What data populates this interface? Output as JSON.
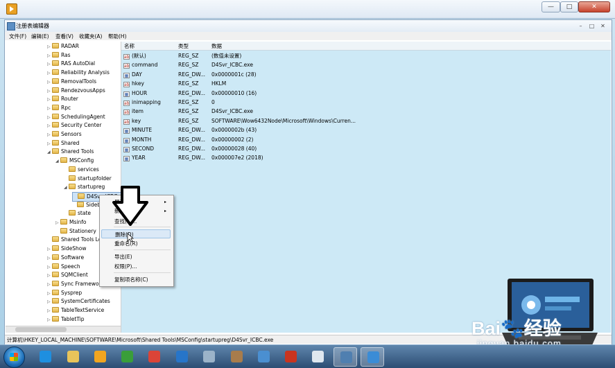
{
  "regedit": {
    "title": "注册表编辑器",
    "menus": [
      "文件(F)",
      "编辑(E)",
      "查看(V)",
      "收藏夹(A)",
      "帮助(H)"
    ],
    "title_controls": {
      "min": "–",
      "max": "□",
      "close": "✕"
    }
  },
  "outer_controls": {
    "min": "—",
    "max": "□",
    "close": "✕"
  },
  "tree": [
    {
      "label": "RADAR",
      "indent": 0,
      "arrow": "▷"
    },
    {
      "label": "Ras",
      "indent": 0,
      "arrow": "▷"
    },
    {
      "label": "RAS AutoDial",
      "indent": 0,
      "arrow": "▷"
    },
    {
      "label": "Reliability Analysis",
      "indent": 0,
      "arrow": "▷"
    },
    {
      "label": "RemovalTools",
      "indent": 0,
      "arrow": "▷"
    },
    {
      "label": "RendezvousApps",
      "indent": 0,
      "arrow": "▷"
    },
    {
      "label": "Router",
      "indent": 0,
      "arrow": "▷"
    },
    {
      "label": "Rpc",
      "indent": 0,
      "arrow": "▷"
    },
    {
      "label": "SchedulingAgent",
      "indent": 0,
      "arrow": "▷"
    },
    {
      "label": "Security Center",
      "indent": 0,
      "arrow": "▷"
    },
    {
      "label": "Sensors",
      "indent": 0,
      "arrow": "▷"
    },
    {
      "label": "Shared",
      "indent": 0,
      "arrow": "▷"
    },
    {
      "label": "Shared Tools",
      "indent": 0,
      "arrow": "◢"
    },
    {
      "label": "MSConfig",
      "indent": 1,
      "arrow": "◢"
    },
    {
      "label": "services",
      "indent": 2,
      "arrow": ""
    },
    {
      "label": "startupfolder",
      "indent": 2,
      "arrow": ""
    },
    {
      "label": "startupreg",
      "indent": 2,
      "arrow": "◢"
    },
    {
      "label": "D4Svr_ICBC.exe",
      "indent": 3,
      "arrow": "",
      "selected": true
    },
    {
      "label": "Sidebar",
      "indent": 3,
      "arrow": ""
    },
    {
      "label": "state",
      "indent": 2,
      "arrow": ""
    },
    {
      "label": "Msinfo",
      "indent": 1,
      "arrow": "▷"
    },
    {
      "label": "Stationery",
      "indent": 1,
      "arrow": ""
    },
    {
      "label": "Shared Tools Location",
      "indent": 0,
      "arrow": ""
    },
    {
      "label": "SideShow",
      "indent": 0,
      "arrow": "▷"
    },
    {
      "label": "Software",
      "indent": 0,
      "arrow": "▷"
    },
    {
      "label": "Speech",
      "indent": 0,
      "arrow": "▷"
    },
    {
      "label": "SQMClient",
      "indent": 0,
      "arrow": "▷"
    },
    {
      "label": "Sync Framework",
      "indent": 0,
      "arrow": "▷"
    },
    {
      "label": "Sysprep",
      "indent": 0,
      "arrow": "▷"
    },
    {
      "label": "SystemCertificates",
      "indent": 0,
      "arrow": "▷"
    },
    {
      "label": "TableTextService",
      "indent": 0,
      "arrow": "▷"
    },
    {
      "label": "TabletTip",
      "indent": 0,
      "arrow": "▷"
    }
  ],
  "columns": {
    "name": "名称",
    "type": "类型",
    "data": "数据"
  },
  "values": [
    {
      "name": "(默认)",
      "type": "REG_SZ",
      "data": "(数值未设置)",
      "icon": "ab"
    },
    {
      "name": "command",
      "type": "REG_SZ",
      "data": "D4Svr_ICBC.exe",
      "icon": "ab"
    },
    {
      "name": "DAY",
      "type": "REG_DW...",
      "data": "0x0000001c (28)",
      "icon": "bin"
    },
    {
      "name": "hkey",
      "type": "REG_SZ",
      "data": "HKLM",
      "icon": "ab"
    },
    {
      "name": "HOUR",
      "type": "REG_DW...",
      "data": "0x00000010 (16)",
      "icon": "bin"
    },
    {
      "name": "inimapping",
      "type": "REG_SZ",
      "data": "0",
      "icon": "ab"
    },
    {
      "name": "item",
      "type": "REG_SZ",
      "data": "D4Svr_ICBC.exe",
      "icon": "ab"
    },
    {
      "name": "key",
      "type": "REG_SZ",
      "data": "SOFTWARE\\Wow6432Node\\Microsoft\\Windows\\Curren...",
      "icon": "ab"
    },
    {
      "name": "MINUTE",
      "type": "REG_DW...",
      "data": "0x0000002b (43)",
      "icon": "bin"
    },
    {
      "name": "MONTH",
      "type": "REG_DW...",
      "data": "0x00000002 (2)",
      "icon": "bin"
    },
    {
      "name": "SECOND",
      "type": "REG_DW...",
      "data": "0x00000028 (40)",
      "icon": "bin"
    },
    {
      "name": "YEAR",
      "type": "REG_DW...",
      "data": "0x000007e2 (2018)",
      "icon": "bin"
    }
  ],
  "context_menu": {
    "items": [
      {
        "label": "展开",
        "submenu": "▸"
      },
      {
        "label": "新建(N)",
        "submenu": "▸"
      },
      {
        "label": "查找(F)..."
      },
      {
        "label": "删除(D)",
        "highlighted": true
      },
      {
        "label": "重命名(R)"
      },
      {
        "label": "导出(E)"
      },
      {
        "label": "权限(P)..."
      },
      {
        "label": "复制项名称(C)"
      }
    ]
  },
  "status_path": "计算机\\HKEY_LOCAL_MACHINE\\SOFTWARE\\Microsoft\\Shared Tools\\MSConfig\\startupreg\\D4Svr_ICBC.exe",
  "watermark": {
    "baidu": "Bai",
    "baidu_suffix": "经验",
    "site": "jingyan.baidu.com"
  },
  "colors": {
    "accent": "#cde9f6",
    "selection": "#cde3f7",
    "taskbar": "#2c4d73"
  },
  "taskbar": [
    {
      "name": "ie-icon",
      "color": "#1e8fe0"
    },
    {
      "name": "explorer-icon",
      "color": "#e8c45a"
    },
    {
      "name": "media-player-icon",
      "color": "#f1a520"
    },
    {
      "name": "tool-icon",
      "color": "#3a9e3a"
    },
    {
      "name": "chrome-icon",
      "color": "#db4437"
    },
    {
      "name": "browser-icon",
      "color": "#2775c9"
    },
    {
      "name": "network-icon",
      "color": "#9bb3c9"
    },
    {
      "name": "paint-icon",
      "color": "#a87c4c"
    },
    {
      "name": "remote-desktop-icon",
      "color": "#4a8fd1"
    },
    {
      "name": "chess-icon",
      "color": "#c9341f"
    },
    {
      "name": "gear-icon",
      "color": "#dfe7ef"
    },
    {
      "name": "monitor-icon",
      "color": "#4f7fb0"
    },
    {
      "name": "regedit-icon",
      "color": "#3b8cd6"
    }
  ]
}
